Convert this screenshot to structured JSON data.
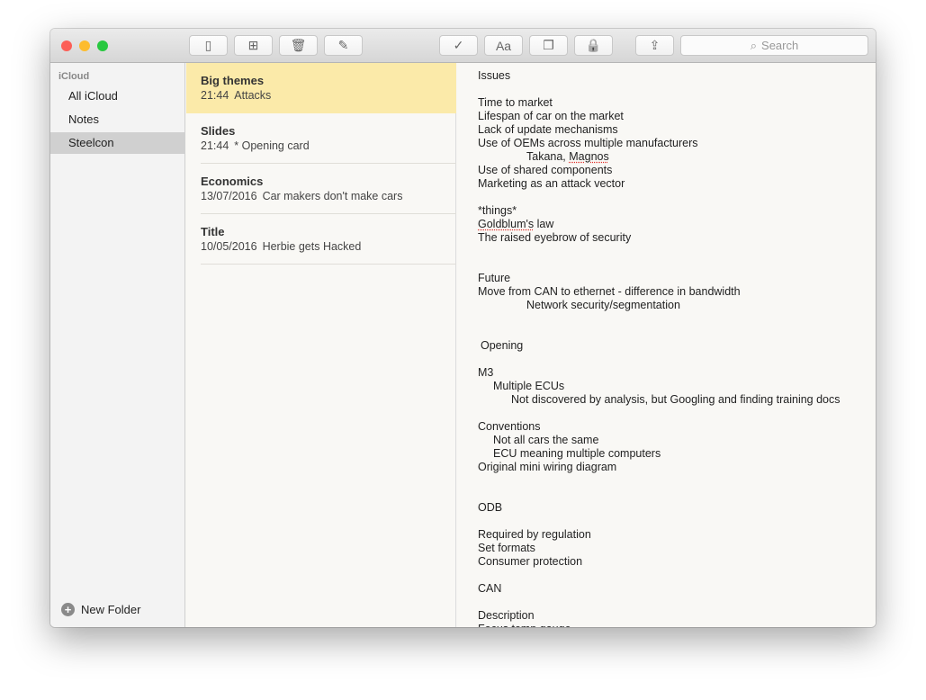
{
  "toolbar": {
    "buttons": [
      {
        "name": "toggle-sidebar-button",
        "icon": "sidebar-icon",
        "glyph": "▯"
      },
      {
        "name": "attachments-button",
        "icon": "grid-icon",
        "glyph": "⊞"
      },
      {
        "name": "delete-button",
        "icon": "trash-icon",
        "glyph": "🗑"
      },
      {
        "name": "compose-button",
        "icon": "compose-icon",
        "glyph": "✎"
      },
      {
        "name": "checklist-button",
        "icon": "checkmark-circle-icon",
        "glyph": "✓"
      },
      {
        "name": "format-button",
        "icon": "text-format-icon",
        "glyph": "Aa"
      },
      {
        "name": "table-button",
        "icon": "windows-icon",
        "glyph": "❐"
      },
      {
        "name": "lock-button",
        "icon": "lock-icon",
        "glyph": "🔒"
      },
      {
        "name": "share-button",
        "icon": "share-icon",
        "glyph": "⇪"
      }
    ],
    "search_placeholder": "Search"
  },
  "sidebar": {
    "section": "iCloud",
    "items": [
      {
        "label": "All iCloud"
      },
      {
        "label": "Notes"
      },
      {
        "label": "Steelcon",
        "selected": true
      }
    ],
    "new_folder": "New Folder"
  },
  "notes_list": [
    {
      "title": "Big themes",
      "date": "21:44",
      "preview": "Attacks",
      "selected": true
    },
    {
      "title": "Slides",
      "date": "21:44",
      "preview": "* Opening card"
    },
    {
      "title": "Economics",
      "date": "13/07/2016",
      "preview": "Car makers don't make cars"
    },
    {
      "title": "Title",
      "date": "10/05/2016",
      "preview": "Herbie gets Hacked"
    }
  ],
  "note": {
    "lines": [
      {
        "text": "Issues",
        "indent": 0
      },
      {
        "text": "",
        "indent": 0
      },
      {
        "text": "Time to market",
        "indent": 0
      },
      {
        "text": "Lifespan of car on the market",
        "indent": 0
      },
      {
        "text": "Lack of update mechanisms",
        "indent": 0
      },
      {
        "text": "Use of OEMs across multiple manufacturers",
        "indent": 0
      },
      {
        "text": "Takana, Magnos",
        "indent": 54
      },
      {
        "text": "Use of shared components",
        "indent": 0
      },
      {
        "text": "Marketing as an attack vector",
        "indent": 0
      },
      {
        "text": "",
        "indent": 0
      },
      {
        "text": "*things*",
        "indent": 0
      },
      {
        "text": "Goldblum's law",
        "indent": 0
      },
      {
        "text": "The raised eyebrow of security",
        "indent": 0
      },
      {
        "text": "",
        "indent": 0
      },
      {
        "text": "",
        "indent": 0
      },
      {
        "text": "Future",
        "indent": 0
      },
      {
        "text": "Move from CAN to ethernet - difference in bandwidth",
        "indent": 0
      },
      {
        "text": "Network security/segmentation",
        "indent": 54
      },
      {
        "text": "",
        "indent": 0
      },
      {
        "text": "",
        "indent": 0
      },
      {
        "text": "Opening",
        "indent": 3
      },
      {
        "text": "",
        "indent": 0
      },
      {
        "text": "M3",
        "indent": 0
      },
      {
        "text": "Multiple ECUs",
        "indent": 17
      },
      {
        "text": "Not discovered by analysis, but Googling and finding training docs",
        "indent": 37
      },
      {
        "text": "",
        "indent": 0
      },
      {
        "text": "Conventions",
        "indent": 0
      },
      {
        "text": "Not all cars the same",
        "indent": 17
      },
      {
        "text": "ECU meaning multiple computers",
        "indent": 17
      },
      {
        "text": "Original mini wiring diagram",
        "indent": 0
      },
      {
        "text": "",
        "indent": 0
      },
      {
        "text": "",
        "indent": 0
      },
      {
        "text": "ODB",
        "indent": 0
      },
      {
        "text": "",
        "indent": 0
      },
      {
        "text": "Required by regulation",
        "indent": 0
      },
      {
        "text": "Set formats",
        "indent": 0
      },
      {
        "text": "Consumer protection",
        "indent": 0
      },
      {
        "text": "",
        "indent": 0
      },
      {
        "text": "CAN",
        "indent": 0
      },
      {
        "text": "",
        "indent": 0
      },
      {
        "text": "Description",
        "indent": 0
      },
      {
        "text": "Focus temp gauge",
        "indent": 0
      }
    ]
  },
  "colors": {
    "close": "#fc5f57",
    "minimize": "#fdbc2e",
    "zoom": "#28c840",
    "selected_note": "#fbeaa9",
    "selected_folder": "#d0d0d0"
  }
}
